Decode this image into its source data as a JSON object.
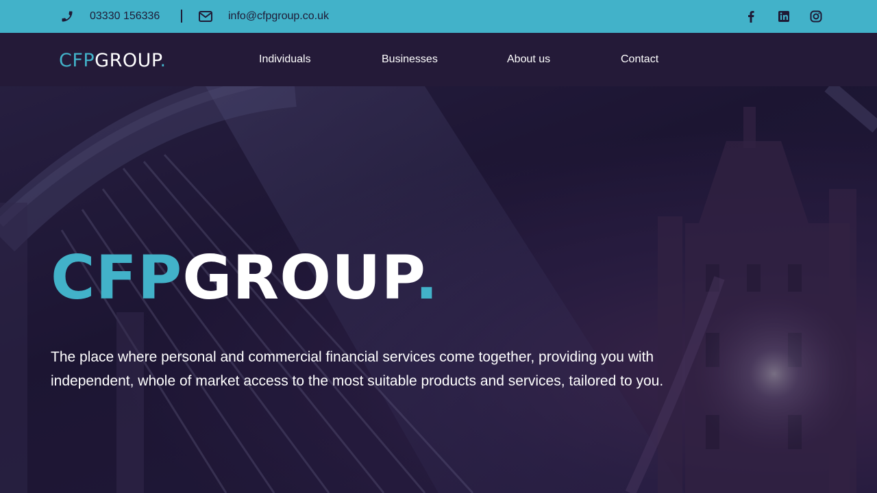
{
  "topbar": {
    "phone": "03330 156336",
    "email": "info@cfpgroup.co.uk",
    "social": [
      "facebook-icon",
      "linkedin-icon",
      "instagram-icon"
    ],
    "background": "#42b2c9"
  },
  "brand": {
    "part1": "CFP",
    "part2": "GROUP",
    "dot": ".",
    "accent": "#42b2c9"
  },
  "nav": {
    "items": [
      "Individuals",
      "Businesses",
      "About us",
      "Contact"
    ]
  },
  "hero": {
    "title_part1": "CFP",
    "title_part2": "GROUP",
    "title_dot": ".",
    "description": "The place where personal and commercial financial services come together, providing you with independent, whole of market access to the most suitable products and services, tailored to you."
  }
}
